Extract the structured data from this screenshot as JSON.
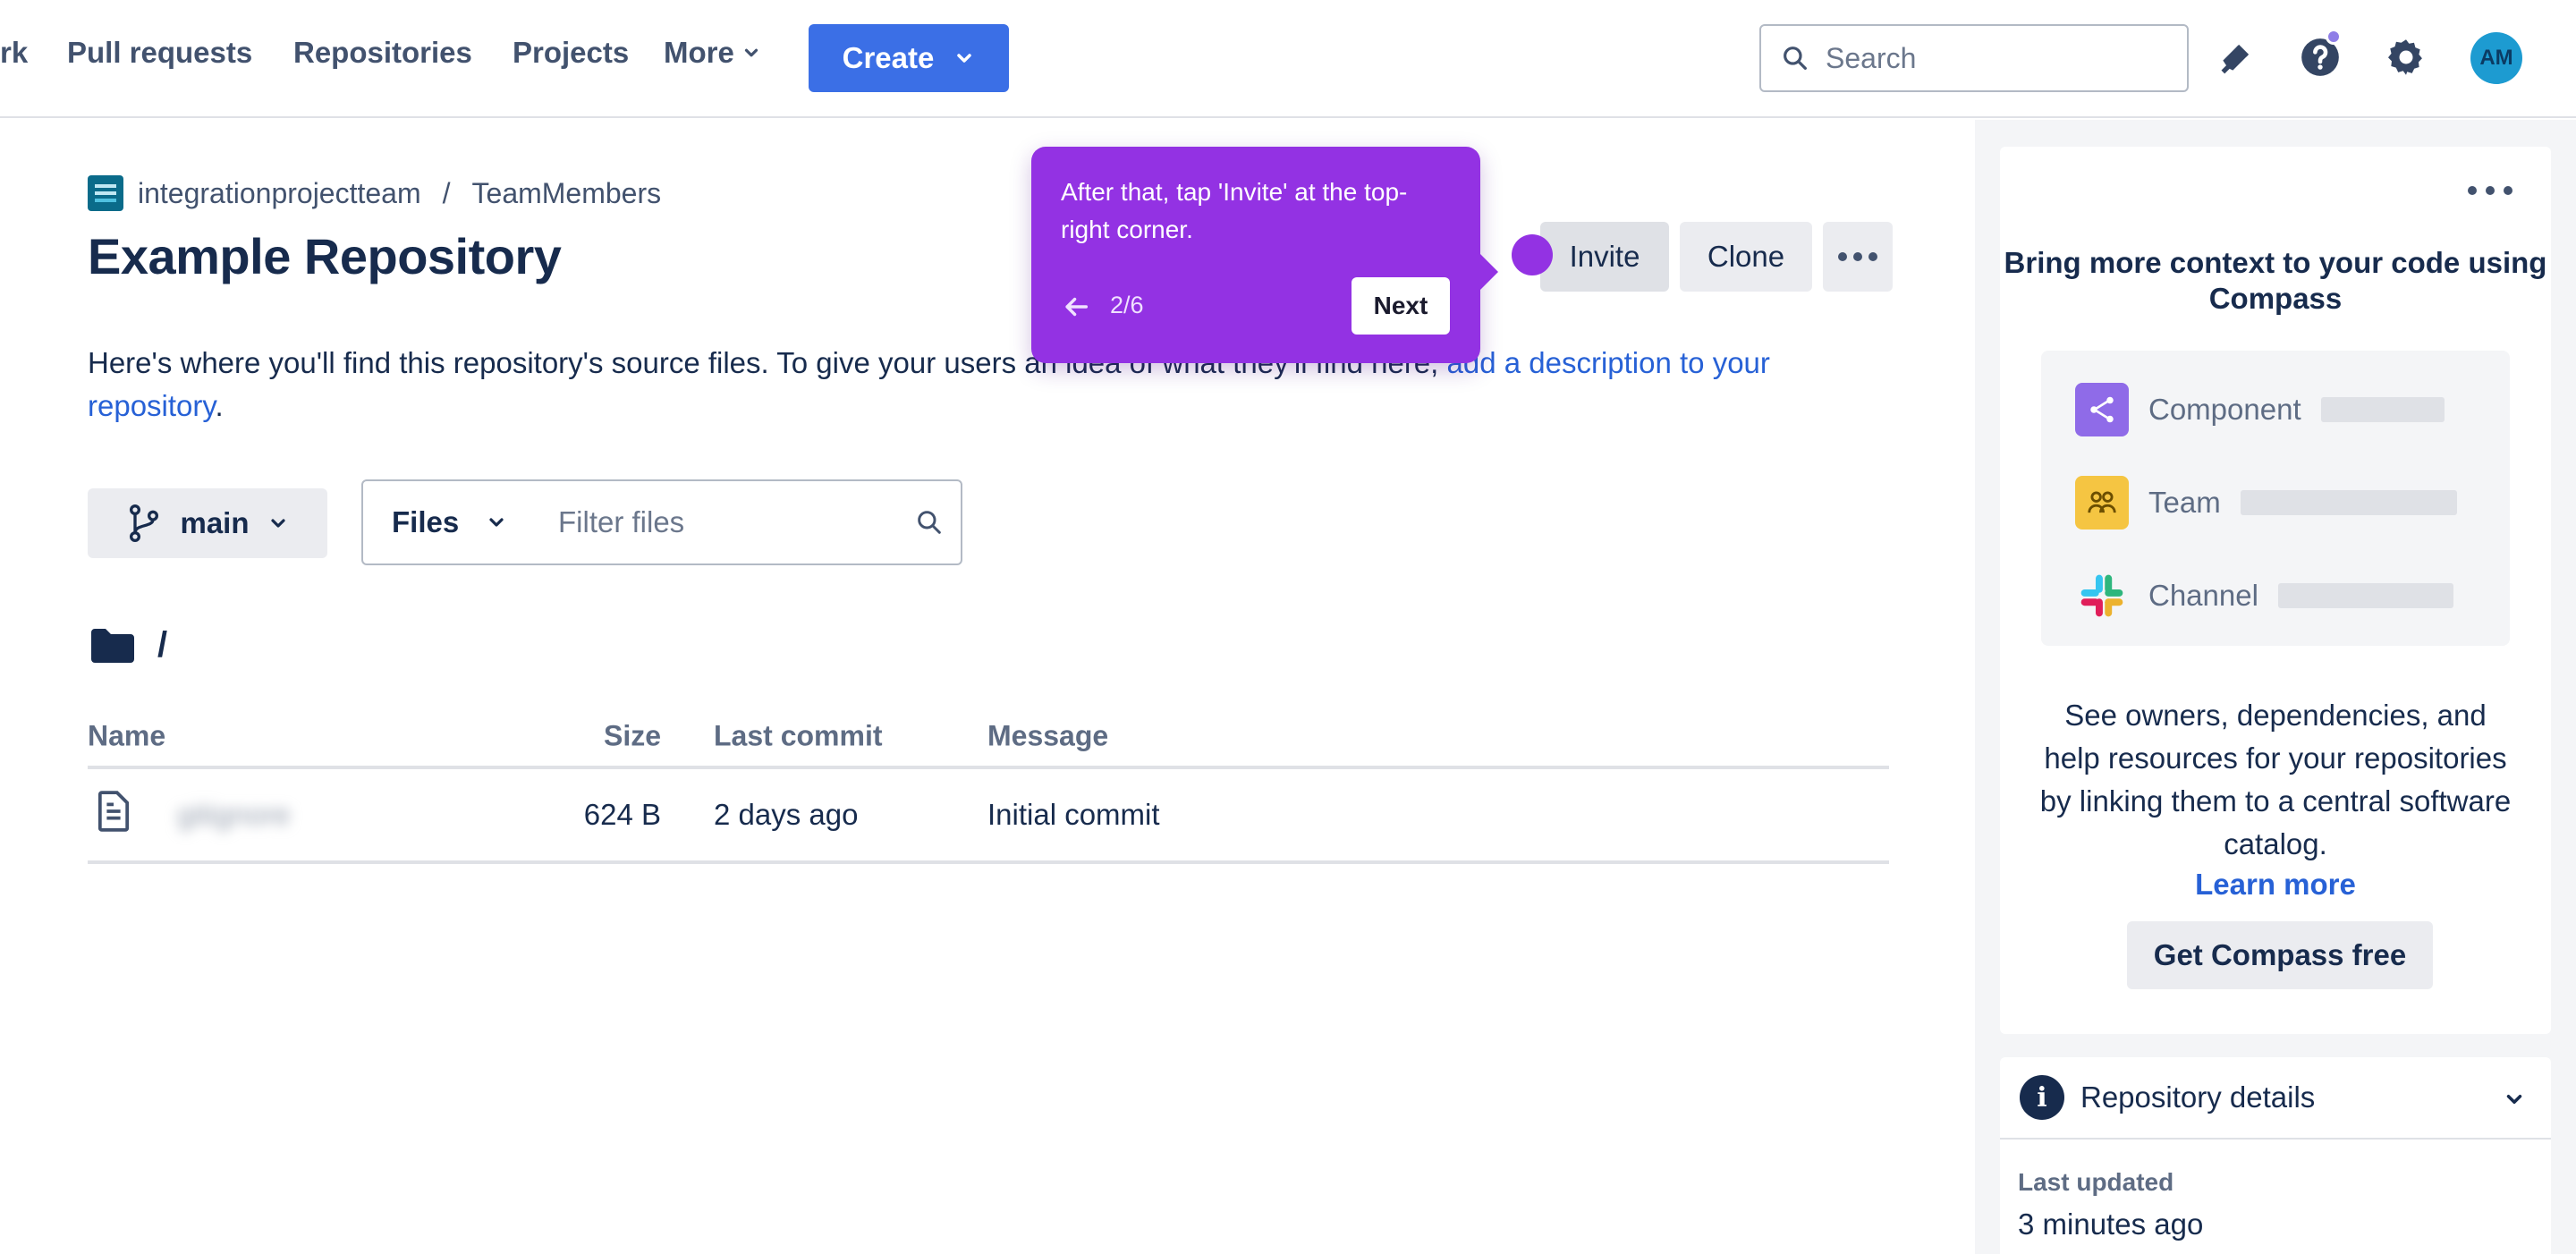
{
  "nav": {
    "partial_link": "rk",
    "links": [
      "Pull requests",
      "Repositories",
      "Projects"
    ],
    "more": "More",
    "create": "Create",
    "search_placeholder": "Search",
    "avatar_initials": "AM"
  },
  "repo": {
    "workspace": "integrationprojectteam",
    "separator": "/",
    "project": "TeamMembers",
    "title": "Example Repository",
    "actions": {
      "invite": "Invite",
      "clone": "Clone"
    },
    "description_text": "Here's where you'll find this repository's source files. To give your users an idea of what they'll find here, ",
    "description_link": "add a description to your repository",
    "description_end": ".",
    "branch": "main",
    "filter_type": "Files",
    "filter_placeholder": "Filter files",
    "path": "/",
    "table": {
      "headers": {
        "name": "Name",
        "size": "Size",
        "last_commit": "Last commit",
        "message": "Message"
      },
      "rows": [
        {
          "name": "gitignore",
          "size": "624 B",
          "last_commit": "2 days ago",
          "message": "Initial commit"
        }
      ]
    }
  },
  "tour": {
    "text": "After that, tap 'Invite' at the top-right corner.",
    "step": "2/6",
    "next": "Next"
  },
  "sidebar": {
    "compass": {
      "title": "Bring more context to your code using Compass",
      "items": [
        "Component",
        "Team",
        "Channel"
      ],
      "body": "See owners, dependencies, and help resources for your repositories by linking them to a central software catalog.",
      "link": "Learn more",
      "button": "Get Compass free"
    },
    "details": {
      "title": "Repository details",
      "label": "Last updated",
      "value": "3 minutes ago"
    }
  },
  "colors": {
    "accent": "#3b6fe6",
    "tour": "#9332e3",
    "link": "#2761d6"
  }
}
